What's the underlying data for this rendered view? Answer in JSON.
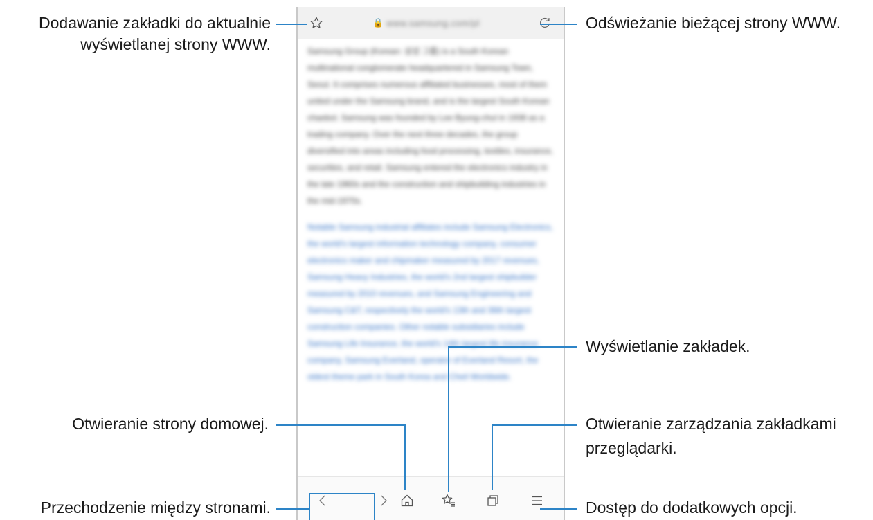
{
  "browser": {
    "url_text": "www.samsung.com/pl",
    "lock_icon": "lock-icon",
    "content": {
      "paragraph1": "Samsung Group (Korean: 삼성 그룹) is a South Korean multinational conglomerate headquartered in Samsung Town, Seoul. It comprises numerous affiliated businesses, most of them united under the Samsung brand, and is the largest South Korean chaebol. Samsung was founded by Lee Byung-chul in 1938 as a trading company. Over the next three decades, the group diversified into areas including food processing, textiles, insurance, securities, and retail. Samsung entered the electronics industry in the late 1960s and the construction and shipbuilding industries in the mid-1970s.",
      "paragraph2": "Notable Samsung industrial affiliates include Samsung Electronics, the world's largest information technology company, consumer electronics maker and chipmaker measured by 2017 revenues, Samsung Heavy Industries, the world's 2nd largest shipbuilder measured by 2010 revenues, and Samsung Engineering and Samsung C&T, respectively the world's 13th and 36th largest construction companies. Other notable subsidiaries include Samsung Life Insurance, the world's 14th largest life insurance company, Samsung Everland, operator of Everland Resort, the oldest theme park in South Korea and Cheil Worldwide."
    },
    "toolbar": [
      "back-icon",
      "forward-icon",
      "home-icon",
      "bookmarks-icon",
      "tabs-icon",
      "menu-icon"
    ]
  },
  "callouts": {
    "bookmark_line1": "Dodawanie zakładki do aktualnie",
    "bookmark_line2": "wyświetlanej strony WWW.",
    "refresh": "Odświeżanie bieżącej strony WWW.",
    "bookmarks_view": "Wyświetlanie zakładek.",
    "home": "Otwieranie strony domowej.",
    "tabs_line1": "Otwieranie zarządzania zakładkami",
    "tabs_line2": "przeglądarki.",
    "navigate": "Przechodzenie między stronami.",
    "options": "Dostęp do dodatkowych opcji."
  },
  "colors": {
    "accent": "#2d84c7",
    "link": "#2f6fc4"
  }
}
